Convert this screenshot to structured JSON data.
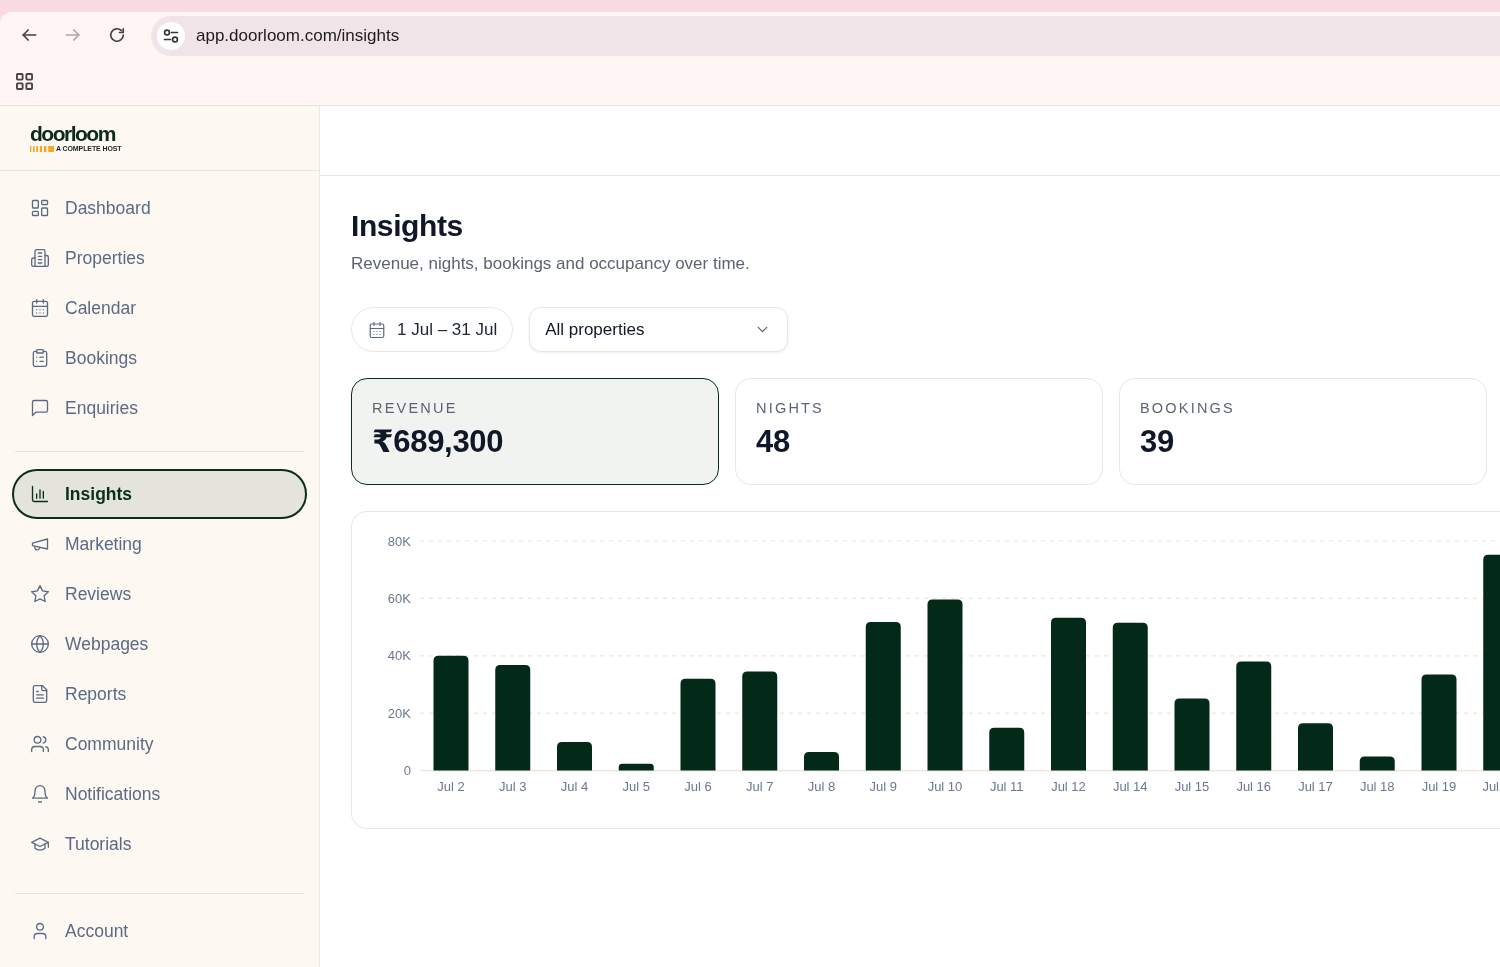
{
  "browser": {
    "nav_buttons": [
      {
        "kind": "back",
        "disabled": false
      },
      {
        "kind": "forward",
        "disabled": true
      },
      {
        "kind": "reload",
        "disabled": false
      }
    ],
    "url": "app.doorloom.com/insights"
  },
  "sidebar": {
    "logo": {
      "wordmark": "doorloom",
      "tagline": "A COMPLETE HOST"
    },
    "sections": [
      {
        "items": [
          {
            "kind": "dashboard",
            "label": "Dashboard",
            "selected": false
          },
          {
            "kind": "properties",
            "label": "Properties",
            "selected": false
          },
          {
            "kind": "calendar",
            "label": "Calendar",
            "selected": false
          },
          {
            "kind": "bookings",
            "label": "Bookings",
            "selected": false
          },
          {
            "kind": "enquiries",
            "label": "Enquiries",
            "selected": false
          }
        ]
      },
      {
        "items": [
          {
            "kind": "insights",
            "label": "Insights",
            "selected": true
          },
          {
            "kind": "marketing",
            "label": "Marketing",
            "selected": false
          },
          {
            "kind": "reviews",
            "label": "Reviews",
            "selected": false
          },
          {
            "kind": "webpages",
            "label": "Webpages",
            "selected": false
          },
          {
            "kind": "reports",
            "label": "Reports",
            "selected": false
          },
          {
            "kind": "community",
            "label": "Community",
            "selected": false
          },
          {
            "kind": "notifications",
            "label": "Notifications",
            "selected": false
          },
          {
            "kind": "tutorials",
            "label": "Tutorials",
            "selected": false
          }
        ]
      },
      {
        "items": [
          {
            "kind": "account",
            "label": "Account",
            "selected": false
          }
        ]
      }
    ]
  },
  "page": {
    "title": "Insights",
    "subtitle": "Revenue, nights, bookings and occupancy over time."
  },
  "filters": {
    "date_range": "1 Jul – 31 Jul",
    "property": {
      "value": "All properties"
    }
  },
  "stats": [
    {
      "label": "REVENUE",
      "value": "₹689,300",
      "selected": true
    },
    {
      "label": "NIGHTS",
      "value": "48",
      "selected": false
    },
    {
      "label": "BOOKINGS",
      "value": "39",
      "selected": false
    }
  ],
  "chart": {
    "chart_data": {
      "type": "bar",
      "categories": [
        "Jul 2",
        "Jul 3",
        "Jul 4",
        "Jul 5",
        "Jul 6",
        "Jul 7",
        "Jul 8",
        "Jul 9",
        "Jul 10",
        "Jul 11",
        "Jul 12",
        "Jul 14",
        "Jul 15",
        "Jul 16",
        "Jul 17",
        "Jul 18",
        "Jul 19",
        "Jul"
      ],
      "values": [
        40000,
        36800,
        10000,
        2400,
        32000,
        34500,
        6500,
        51800,
        59600,
        14900,
        53300,
        51500,
        25100,
        38000,
        16500,
        4900,
        33500,
        75200
      ],
      "ylim": [
        0,
        80000
      ],
      "yticks": [
        {
          "value": 0,
          "label": "0"
        },
        {
          "value": 20000,
          "label": "20K"
        },
        {
          "value": 40000,
          "label": "40K"
        },
        {
          "value": 60000,
          "label": "60K"
        },
        {
          "value": 80000,
          "label": "80K"
        }
      ],
      "grid": true
    }
  }
}
